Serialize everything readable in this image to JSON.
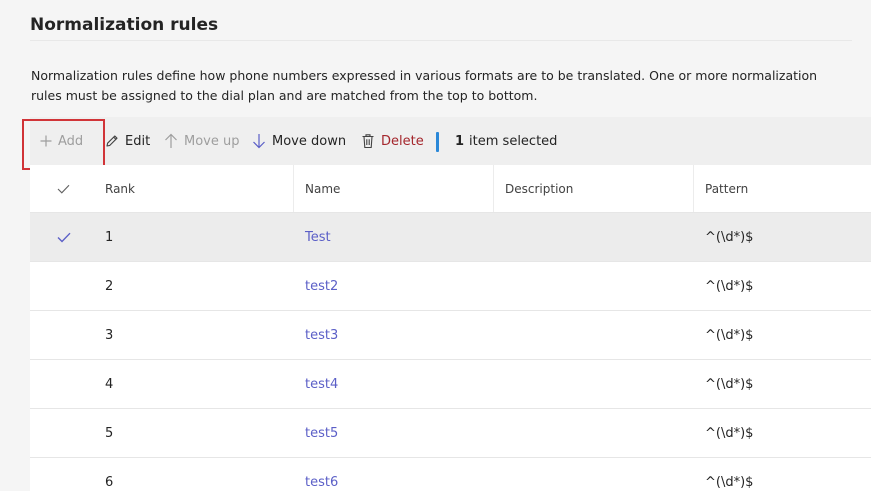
{
  "page": {
    "title": "Normalization rules",
    "description": "Normalization rules define how phone numbers expressed in various formats are to be translated. One or more normalization rules must be assigned to the dial plan and are matched from the top to bottom."
  },
  "toolbar": {
    "add_label": "Add",
    "edit_label": "Edit",
    "move_up_label": "Move up",
    "move_down_label": "Move down",
    "delete_label": "Delete",
    "selection_count": "1",
    "selection_text": "item selected"
  },
  "table": {
    "columns": {
      "rank": "Rank",
      "name": "Name",
      "description": "Description",
      "pattern": "Pattern"
    },
    "rows": [
      {
        "rank": "1",
        "name": "Test",
        "description": "",
        "pattern": "^(\\d*)$",
        "selected": true
      },
      {
        "rank": "2",
        "name": "test2",
        "description": "",
        "pattern": "^(\\d*)$",
        "selected": false
      },
      {
        "rank": "3",
        "name": "test3",
        "description": "",
        "pattern": "^(\\d*)$",
        "selected": false
      },
      {
        "rank": "4",
        "name": "test4",
        "description": "",
        "pattern": "^(\\d*)$",
        "selected": false
      },
      {
        "rank": "5",
        "name": "test5",
        "description": "",
        "pattern": "^(\\d*)$",
        "selected": false
      },
      {
        "rank": "6",
        "name": "test6",
        "description": "",
        "pattern": "^(\\d*)$",
        "selected": false
      }
    ]
  },
  "colors": {
    "link": "#5b5fc7",
    "danger": "#a4262c",
    "highlight_border": "#d13438",
    "selection_indicator": "#2b88d8"
  },
  "icons": {
    "add": "plus-icon",
    "edit": "pencil-icon",
    "move_up": "arrow-up-icon",
    "move_down": "arrow-down-icon",
    "delete": "trash-icon",
    "check": "checkmark-icon"
  }
}
